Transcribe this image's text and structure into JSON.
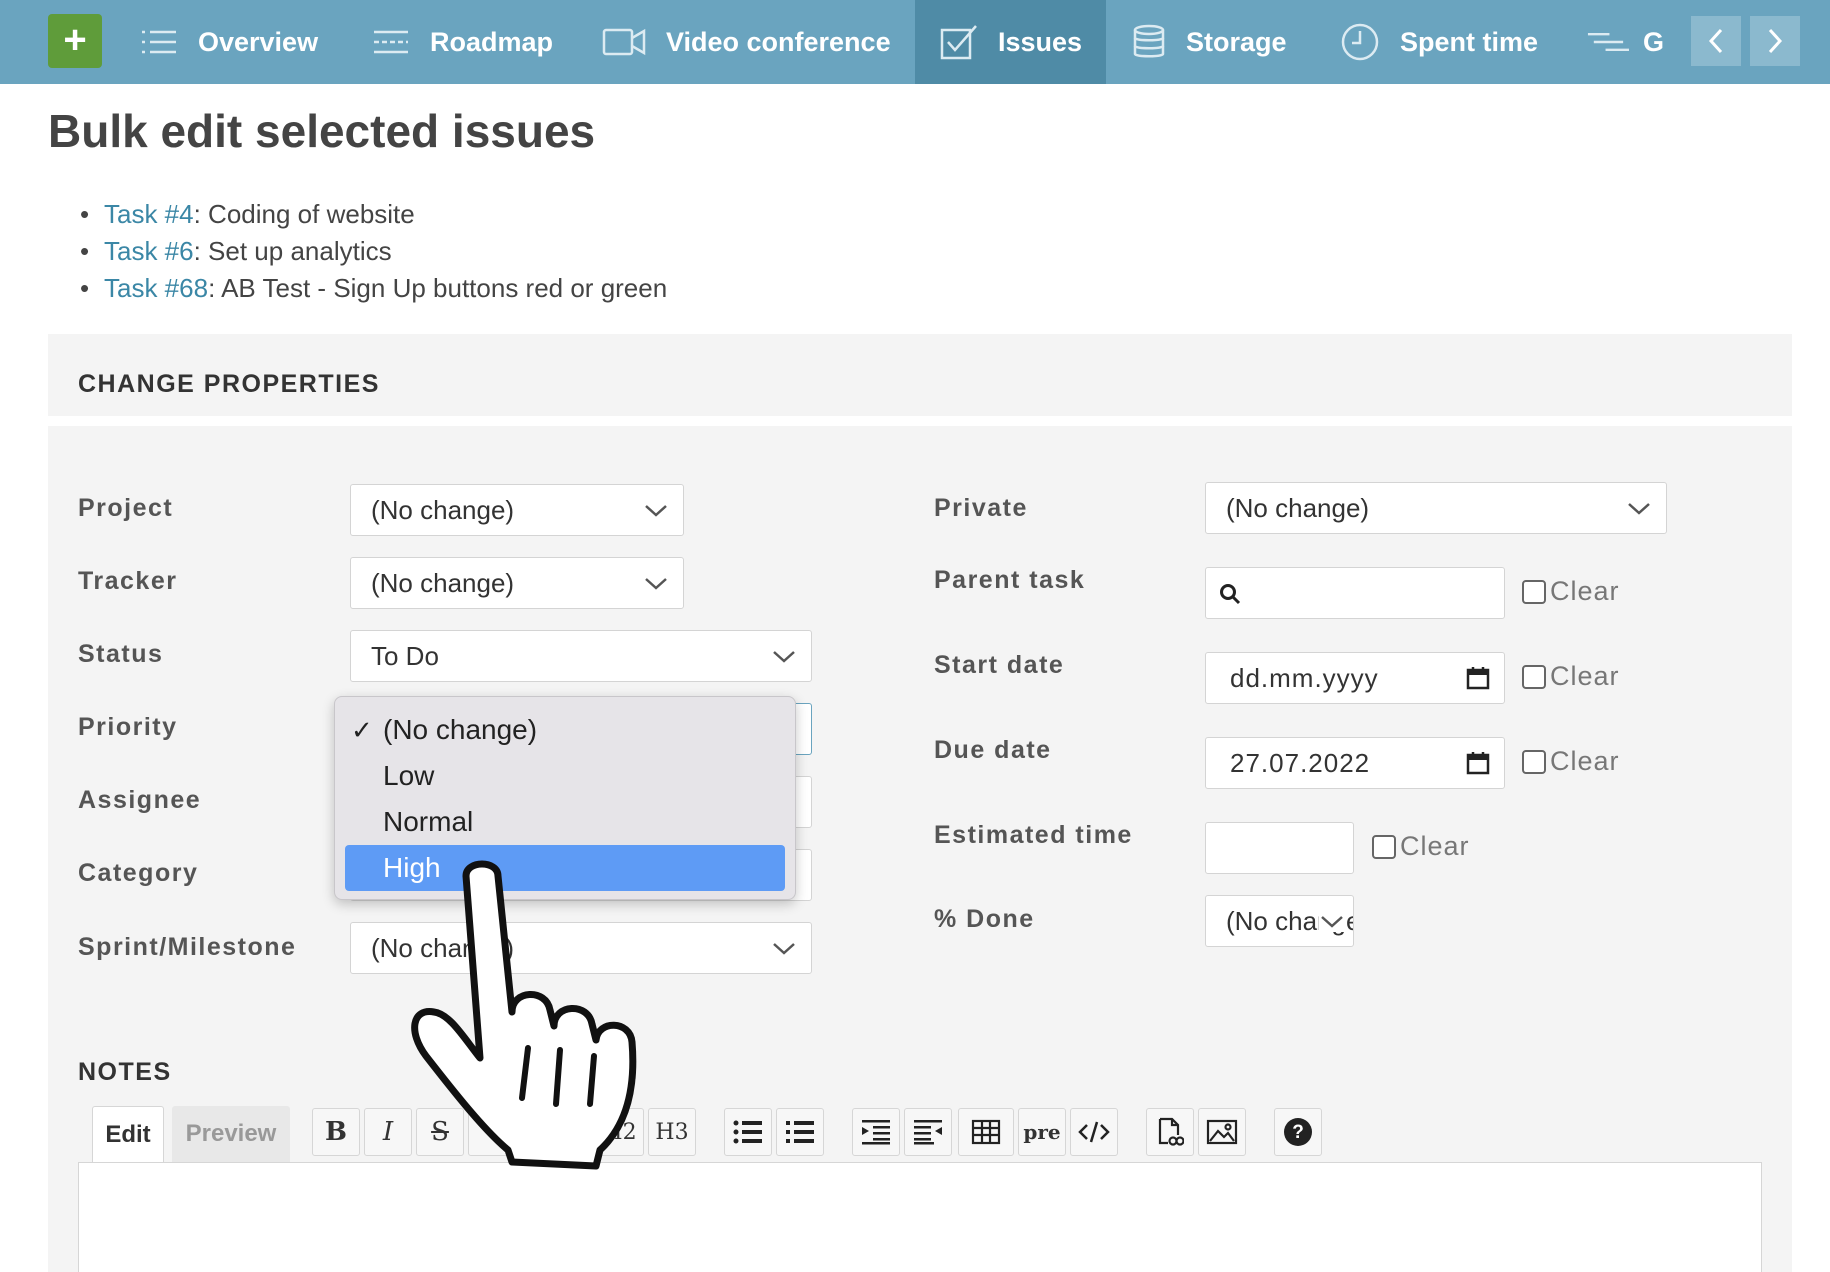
{
  "nav": {
    "plus": "+",
    "tabs": [
      {
        "label": "Overview",
        "icon": "list-icon"
      },
      {
        "label": "Roadmap",
        "icon": "roadmap-icon"
      },
      {
        "label": "Video conference",
        "icon": "video-icon"
      },
      {
        "label": "Issues",
        "icon": "checkbox-icon",
        "active": true
      },
      {
        "label": "Storage",
        "icon": "database-icon"
      },
      {
        "label": "Spent time",
        "icon": "clock-icon"
      },
      {
        "label": "G",
        "icon": "gantt-icon"
      }
    ]
  },
  "page": {
    "title": "Bulk edit selected issues",
    "issues": [
      {
        "link": "Task #4",
        "text": ": Coding of website"
      },
      {
        "link": "Task #6",
        "text": ": Set up analytics"
      },
      {
        "link": "Task #68",
        "text": ": AB Test - Sign Up buttons red or green"
      }
    ]
  },
  "properties": {
    "heading": "CHANGE PROPERTIES",
    "left": {
      "project": {
        "label": "Project",
        "value": "(No change)"
      },
      "tracker": {
        "label": "Tracker",
        "value": "(No change)"
      },
      "status": {
        "label": "Status",
        "value": "To Do"
      },
      "priority": {
        "label": "Priority"
      },
      "assignee": {
        "label": "Assignee"
      },
      "category": {
        "label": "Category"
      },
      "sprint": {
        "label": "Sprint/Milestone",
        "value": "(No change)"
      }
    },
    "right": {
      "private": {
        "label": "Private",
        "value": "(No change)"
      },
      "parent": {
        "label": "Parent task",
        "value": "",
        "clear": "Clear"
      },
      "start": {
        "label": "Start date",
        "value": "dd.mm.yyyy",
        "clear": "Clear"
      },
      "due": {
        "label": "Due date",
        "value": "27.07.2022",
        "clear": "Clear"
      },
      "estimated": {
        "label": "Estimated time",
        "value": "",
        "clear": "Clear"
      },
      "done": {
        "label": "% Done",
        "value": "(No change)"
      }
    }
  },
  "priority_dropdown": {
    "options": [
      "(No change)",
      "Low",
      "Normal",
      "High"
    ],
    "checked": "(No change)",
    "highlighted": "High"
  },
  "notes": {
    "heading": "NOTES",
    "tab_edit": "Edit",
    "tab_preview": "Preview",
    "toolbar": {
      "bold": "B",
      "italic": "I",
      "strike": "S",
      "h2": "H2",
      "h3": "H3",
      "pre": "pre"
    }
  },
  "colors": {
    "nav_bg": "#6aa4bf",
    "nav_active": "#4f8ba6",
    "plus_btn": "#5f9c3a",
    "link": "#3b87a6",
    "highlight": "#5e9bf5"
  }
}
